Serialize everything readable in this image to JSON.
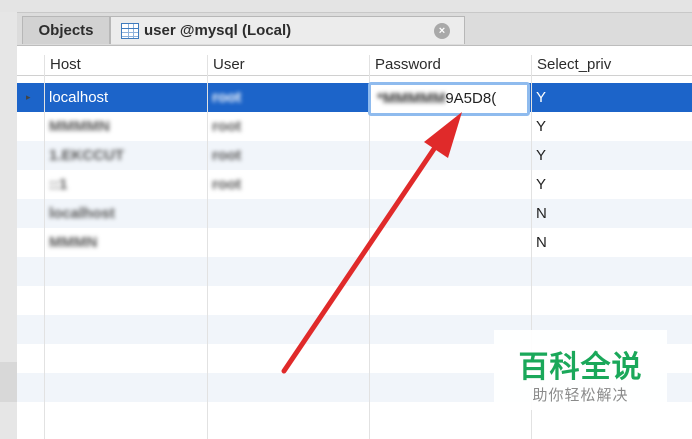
{
  "tabs": {
    "objects_label": "Objects",
    "table_tab_label": "user @mysql (Local)",
    "table_tab_icon": "table-icon",
    "close_icon": "close-icon",
    "close_glyph": "×"
  },
  "grid": {
    "columns": [
      "Host",
      "User",
      "Password",
      "Select_priv"
    ],
    "row_indicator": "▸",
    "rows": [
      {
        "host": "localhost",
        "user": "root",
        "password": "",
        "select_priv": "Y",
        "selected": true
      },
      {
        "host": "MMMMN",
        "user": "root",
        "password": "",
        "select_priv": "Y"
      },
      {
        "host": "1.EKCCUT",
        "user": "root",
        "password": "",
        "select_priv": "Y"
      },
      {
        "host": "::1",
        "user": "root",
        "password": "",
        "select_priv": "Y"
      },
      {
        "host": "localhost",
        "user": "",
        "password": "",
        "select_priv": "N"
      },
      {
        "host": "MMMN",
        "user": "",
        "password": "",
        "select_priv": "N"
      }
    ],
    "editing_password_value": "*MMMMMA9A5D8C",
    "editing_password_visible_suffix": "9A5D8("
  },
  "watermark": {
    "main": "百科全说",
    "sub": "助你轻松解决"
  },
  "colors": {
    "selection": "#1c64c9",
    "arrow": "#e02a2a",
    "watermark_green": "#1aa85a"
  }
}
